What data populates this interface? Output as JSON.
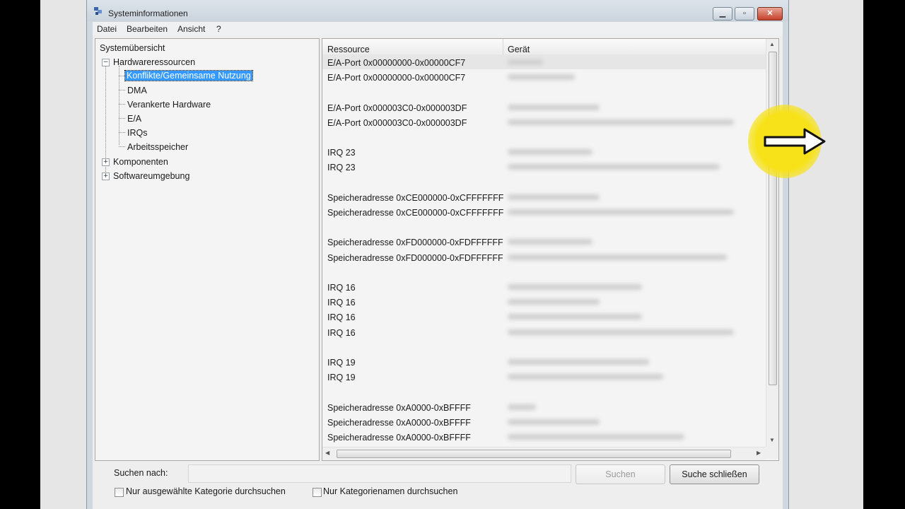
{
  "window": {
    "title": "Systeminformationen"
  },
  "menu": {
    "items": [
      "Datei",
      "Bearbeiten",
      "Ansicht",
      "?"
    ]
  },
  "tree": {
    "root": "Systemübersicht",
    "hardware": "Hardwareressourcen",
    "children": [
      "Konflikte/Gemeinsame Nutzung",
      "DMA",
      "Verankerte Hardware",
      "E/A",
      "IRQs",
      "Arbeitsspeicher"
    ],
    "components": "Komponenten",
    "software": "Softwareumgebung"
  },
  "list": {
    "columns": [
      "Ressource",
      "Gerät"
    ],
    "rows": [
      "E/A-Port 0x00000000-0x00000CF7",
      "E/A-Port 0x00000000-0x00000CF7",
      "",
      "E/A-Port 0x000003C0-0x000003DF",
      "E/A-Port 0x000003C0-0x000003DF",
      "",
      "IRQ 23",
      "IRQ 23",
      "",
      "Speicheradresse 0xCE000000-0xCFFFFFFF",
      "Speicheradresse 0xCE000000-0xCFFFFFFF",
      "",
      "Speicheradresse 0xFD000000-0xFDFFFFFF",
      "Speicheradresse 0xFD000000-0xFDFFFFFF",
      "",
      "IRQ 16",
      "IRQ 16",
      "IRQ 16",
      "IRQ 16",
      "",
      "IRQ 19",
      "IRQ 19",
      "",
      "Speicheradresse 0xA0000-0xBFFFF",
      "Speicheradresse 0xA0000-0xBFFFF",
      "Speicheradresse 0xA0000-0xBFFFF"
    ]
  },
  "search": {
    "label": "Suchen nach:",
    "value": "",
    "search_button": "Suchen",
    "close_button": "Suche schließen",
    "checkbox1": "Nur ausgewählte Kategorie durchsuchen",
    "checkbox2": "Nur Kategorienamen durchsuchen"
  },
  "colors": {
    "highlight": "#f7e21a",
    "selection": "#3399ff"
  }
}
